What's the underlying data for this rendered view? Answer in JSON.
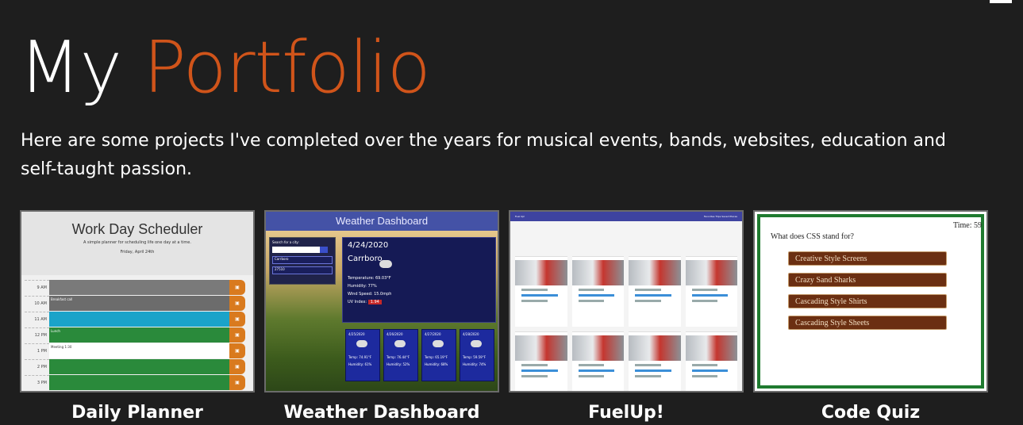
{
  "header": {
    "title_plain": "My",
    "title_accent": "Portfolio",
    "intro": "Here are some projects I've completed over the years for musical events, bands, websites, education and self-taught passion."
  },
  "colors": {
    "background": "#1e1e1e",
    "accent": "#d0541a",
    "text": "#ffffff"
  },
  "projects": [
    {
      "label": "Daily Planner",
      "preview": {
        "title": "Work Day Scheduler",
        "subtitle": "A simple planner for scheduling life one day at a time.",
        "date": "Friday, April 24th",
        "rows": [
          {
            "hour": "9 AM",
            "text": "",
            "color": "#7a7a7a"
          },
          {
            "hour": "10 AM",
            "text": "Breakfast call",
            "color": "#6c6c6c"
          },
          {
            "hour": "11 AM",
            "text": "",
            "color": "#1aa3c9"
          },
          {
            "hour": "12 PM",
            "text": "Lunch",
            "color": "#2a8a3b"
          },
          {
            "hour": "1 PM",
            "text": "Meeting 1:30",
            "color": "#ffffff"
          },
          {
            "hour": "2 PM",
            "text": "",
            "color": "#2a8a3b"
          },
          {
            "hour": "3 PM",
            "text": "",
            "color": "#2a8a3b"
          }
        ]
      }
    },
    {
      "label": "Weather Dashboard",
      "preview": {
        "title": "Weather Dashboard",
        "search_label": "Search for a city:",
        "history": [
          "Carrboro",
          "27510"
        ],
        "date": "4/24/2020",
        "city": "Carrboro",
        "temperature": "Temperature: 69.03°F",
        "humidity": "Humidity: 77%",
        "wind": "Wind Speed: 15.0mph",
        "uv_label": "UV Index:",
        "uv_value": "1.94",
        "forecast": [
          {
            "date": "4/25/2020",
            "temp": "Temp: 74.91°F",
            "humidity": "Humidity: 61%"
          },
          {
            "date": "4/26/2020",
            "temp": "Temp: 76.44°F",
            "humidity": "Humidity: 52%"
          },
          {
            "date": "4/27/2020",
            "temp": "Temp: 65.19°F",
            "humidity": "Humidity: 68%"
          },
          {
            "date": "4/28/2020",
            "temp": "Temp: 59.59°F",
            "humidity": "Humidity: 74%"
          }
        ]
      }
    },
    {
      "label": "FuelUp!",
      "preview": {
        "brand": "Fuel Up!",
        "nav": "Favorites  Trips  Saved Places"
      }
    },
    {
      "label": "Code Quiz",
      "preview": {
        "time": "Time: 59",
        "question": "What does CSS stand for?",
        "answers": [
          "Creative Style Screens",
          "Crazy Sand Sharks",
          "Cascading Style Shirts",
          "Cascading Style Sheets"
        ]
      }
    }
  ]
}
